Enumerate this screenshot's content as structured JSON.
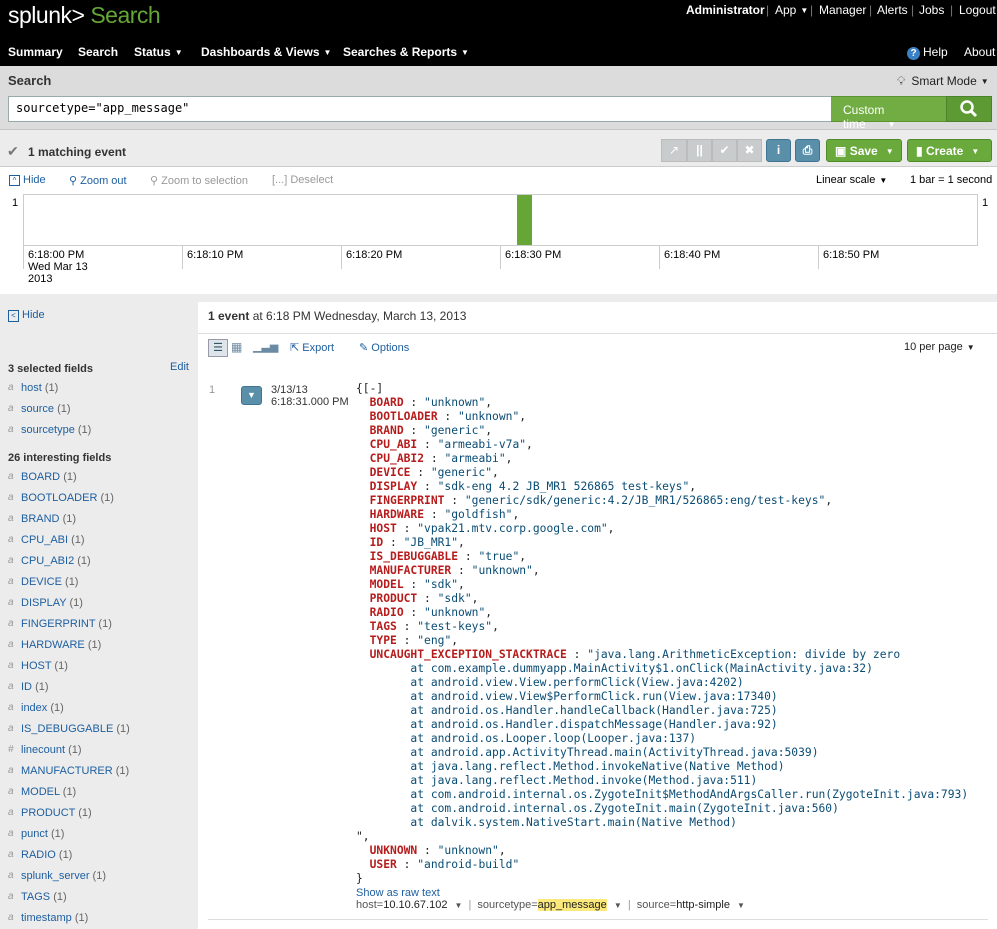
{
  "header": {
    "brand": "splunk>",
    "app": "Search",
    "top_links": [
      "Administrator",
      "App",
      "Manager",
      "Alerts",
      "Jobs",
      "Logout"
    ],
    "nav": [
      "Summary",
      "Search",
      "Status",
      "Dashboards & Views",
      "Searches & Reports"
    ],
    "help": "Help",
    "about": "About"
  },
  "search": {
    "title": "Search",
    "mode": "Smart Mode",
    "query": "sourcetype=\"app_message\"",
    "time": "Custom time"
  },
  "status": {
    "matching": "1 matching event",
    "save": "Save",
    "create": "Create"
  },
  "timeline": {
    "hide": "Hide",
    "zoom_out": "Zoom out",
    "zoom_sel": "Zoom to selection",
    "deselect": "Deselect",
    "scale": "Linear scale",
    "bar": "1 bar = 1 second",
    "y_left": "1",
    "y_right": "1",
    "ticks": [
      "6:18:00 PM",
      "6:18:10 PM",
      "6:18:20 PM",
      "6:18:30 PM",
      "6:18:40 PM",
      "6:18:50 PM"
    ],
    "first_date1": "Wed Mar 13",
    "first_date2": "2013"
  },
  "chart_data": {
    "type": "bar",
    "x": [
      "6:18:30 PM"
    ],
    "values": [
      1
    ],
    "ylim": [
      0,
      1
    ]
  },
  "sidebar": {
    "hide": "Hide",
    "selected_title": "3 selected fields",
    "edit": "Edit",
    "selected": [
      {
        "t": "a",
        "n": "host",
        "c": "(1)"
      },
      {
        "t": "a",
        "n": "source",
        "c": "(1)"
      },
      {
        "t": "a",
        "n": "sourcetype",
        "c": "(1)"
      }
    ],
    "interesting_title": "26 interesting fields",
    "interesting": [
      {
        "t": "a",
        "n": "BOARD",
        "c": "(1)"
      },
      {
        "t": "a",
        "n": "BOOTLOADER",
        "c": "(1)"
      },
      {
        "t": "a",
        "n": "BRAND",
        "c": "(1)"
      },
      {
        "t": "a",
        "n": "CPU_ABI",
        "c": "(1)"
      },
      {
        "t": "a",
        "n": "CPU_ABI2",
        "c": "(1)"
      },
      {
        "t": "a",
        "n": "DEVICE",
        "c": "(1)"
      },
      {
        "t": "a",
        "n": "DISPLAY",
        "c": "(1)"
      },
      {
        "t": "a",
        "n": "FINGERPRINT",
        "c": "(1)"
      },
      {
        "t": "a",
        "n": "HARDWARE",
        "c": "(1)"
      },
      {
        "t": "a",
        "n": "HOST",
        "c": "(1)"
      },
      {
        "t": "a",
        "n": "ID",
        "c": "(1)"
      },
      {
        "t": "a",
        "n": "index",
        "c": "(1)"
      },
      {
        "t": "a",
        "n": "IS_DEBUGGABLE",
        "c": "(1)"
      },
      {
        "t": "#",
        "n": "linecount",
        "c": "(1)"
      },
      {
        "t": "a",
        "n": "MANUFACTURER",
        "c": "(1)"
      },
      {
        "t": "a",
        "n": "MODEL",
        "c": "(1)"
      },
      {
        "t": "a",
        "n": "PRODUCT",
        "c": "(1)"
      },
      {
        "t": "a",
        "n": "punct",
        "c": "(1)"
      },
      {
        "t": "a",
        "n": "RADIO",
        "c": "(1)"
      },
      {
        "t": "a",
        "n": "splunk_server",
        "c": "(1)"
      },
      {
        "t": "a",
        "n": "TAGS",
        "c": "(1)"
      },
      {
        "t": "a",
        "n": "timestamp",
        "c": "(1)"
      }
    ]
  },
  "results": {
    "summary_bold": "1 event",
    "summary_rest": " at 6:18 PM Wednesday, March 13, 2013",
    "export": "Export",
    "options": "Options",
    "per_page": "10 per page",
    "event": {
      "index": "1",
      "date": "3/13/13",
      "time": "6:18:31.000 PM",
      "open": "{[-]",
      "fields": [
        {
          "k": "BOARD",
          "v": "\"unknown\""
        },
        {
          "k": "BOOTLOADER",
          "v": "\"unknown\""
        },
        {
          "k": "BRAND",
          "v": "\"generic\""
        },
        {
          "k": "CPU_ABI",
          "v": "\"armeabi-v7a\""
        },
        {
          "k": "CPU_ABI2",
          "v": "\"armeabi\""
        },
        {
          "k": "DEVICE",
          "v": "\"generic\""
        },
        {
          "k": "DISPLAY",
          "v": "\"sdk-eng 4.2 JB_MR1 526865 test-keys\""
        },
        {
          "k": "FINGERPRINT",
          "v": "\"generic/sdk/generic:4.2/JB_MR1/526865:eng/test-keys\""
        },
        {
          "k": "HARDWARE",
          "v": "\"goldfish\""
        },
        {
          "k": "HOST",
          "v": "\"vpak21.mtv.corp.google.com\""
        },
        {
          "k": "ID",
          "v": "\"JB_MR1\""
        },
        {
          "k": "IS_DEBUGGABLE",
          "v": "\"true\""
        },
        {
          "k": "MANUFACTURER",
          "v": "\"unknown\""
        },
        {
          "k": "MODEL",
          "v": "\"sdk\""
        },
        {
          "k": "PRODUCT",
          "v": "\"sdk\""
        },
        {
          "k": "RADIO",
          "v": "\"unknown\""
        },
        {
          "k": "TAGS",
          "v": "\"test-keys\""
        },
        {
          "k": "TYPE",
          "v": "\"eng\""
        }
      ],
      "trace_key": "UNCAUGHT_EXCEPTION_STACKTRACE",
      "trace_first": "\"java.lang.ArithmeticException: divide by zero",
      "trace": [
        "at com.example.dummyapp.MainActivity$1.onClick(MainActivity.java:32)",
        "at android.view.View.performClick(View.java:4202)",
        "at android.view.View$PerformClick.run(View.java:17340)",
        "at android.os.Handler.handleCallback(Handler.java:725)",
        "at android.os.Handler.dispatchMessage(Handler.java:92)",
        "at android.os.Looper.loop(Looper.java:137)",
        "at android.app.ActivityThread.main(ActivityThread.java:5039)",
        "at java.lang.reflect.Method.invokeNative(Native Method)",
        "at java.lang.reflect.Method.invoke(Method.java:511)",
        "at com.android.internal.os.ZygoteInit$MethodAndArgsCaller.run(ZygoteInit.java:793)",
        "at com.android.internal.os.ZygoteInit.main(ZygoteInit.java:560)",
        "at dalvik.system.NativeStart.main(Native Method)"
      ],
      "trace_close": "\",",
      "tail": [
        {
          "k": "UNKNOWN",
          "v": "\"unknown\""
        },
        {
          "k": "USER",
          "v": "\"android-build\""
        }
      ],
      "close": "}",
      "raw": "Show as raw text",
      "meta": [
        {
          "k": "host=",
          "v": "10.10.67.102"
        },
        {
          "k": "sourcetype=",
          "v": "app_message"
        },
        {
          "k": "source=",
          "v": "http-simple"
        }
      ]
    }
  },
  "colors": {
    "accent": "#65a637",
    "link": "#1e5fa0",
    "key": "#b71c1c"
  }
}
